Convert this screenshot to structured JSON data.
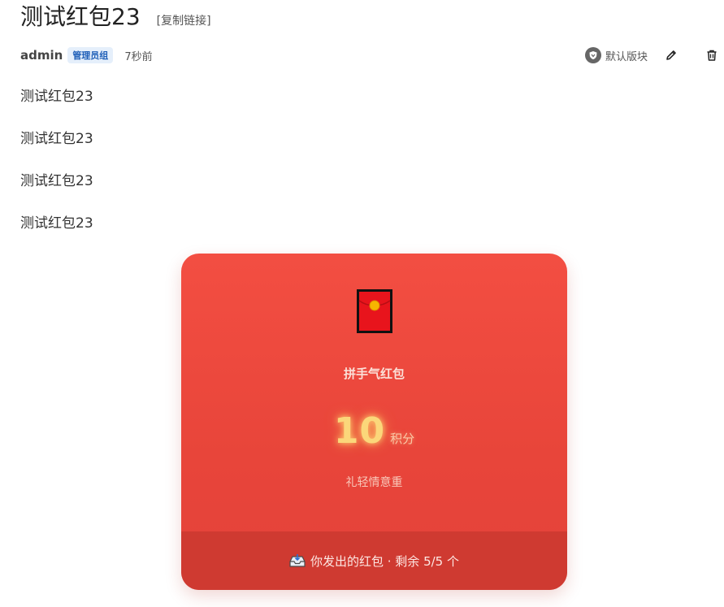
{
  "post": {
    "title": "测试红包23",
    "copy_link": "[复制链接]",
    "author": "admin",
    "group": "管理员组",
    "time": "7秒前"
  },
  "actions": {
    "moderate_label": "默认版块"
  },
  "content": {
    "paragraphs": [
      "测试红包23",
      "测试红包23",
      "测试红包23",
      "测试红包23"
    ]
  },
  "red_packet": {
    "type": "拼手气红包",
    "amount": "10",
    "unit": "积分",
    "blessing": "礼轻情意重",
    "footer": "你发出的红包 · 剩余 5/5 个"
  },
  "colors": {
    "packet_red": "#e8453a",
    "footer_red": "#cf3a31",
    "amount_gold": "#fbd77a",
    "badge_blue": "#1f5fb8"
  },
  "icons": {
    "moderate": "shield-icon",
    "edit": "pencil-icon",
    "delete": "trash-icon",
    "envelope": "red-envelope-icon",
    "footer": "inbox-tray-icon"
  }
}
